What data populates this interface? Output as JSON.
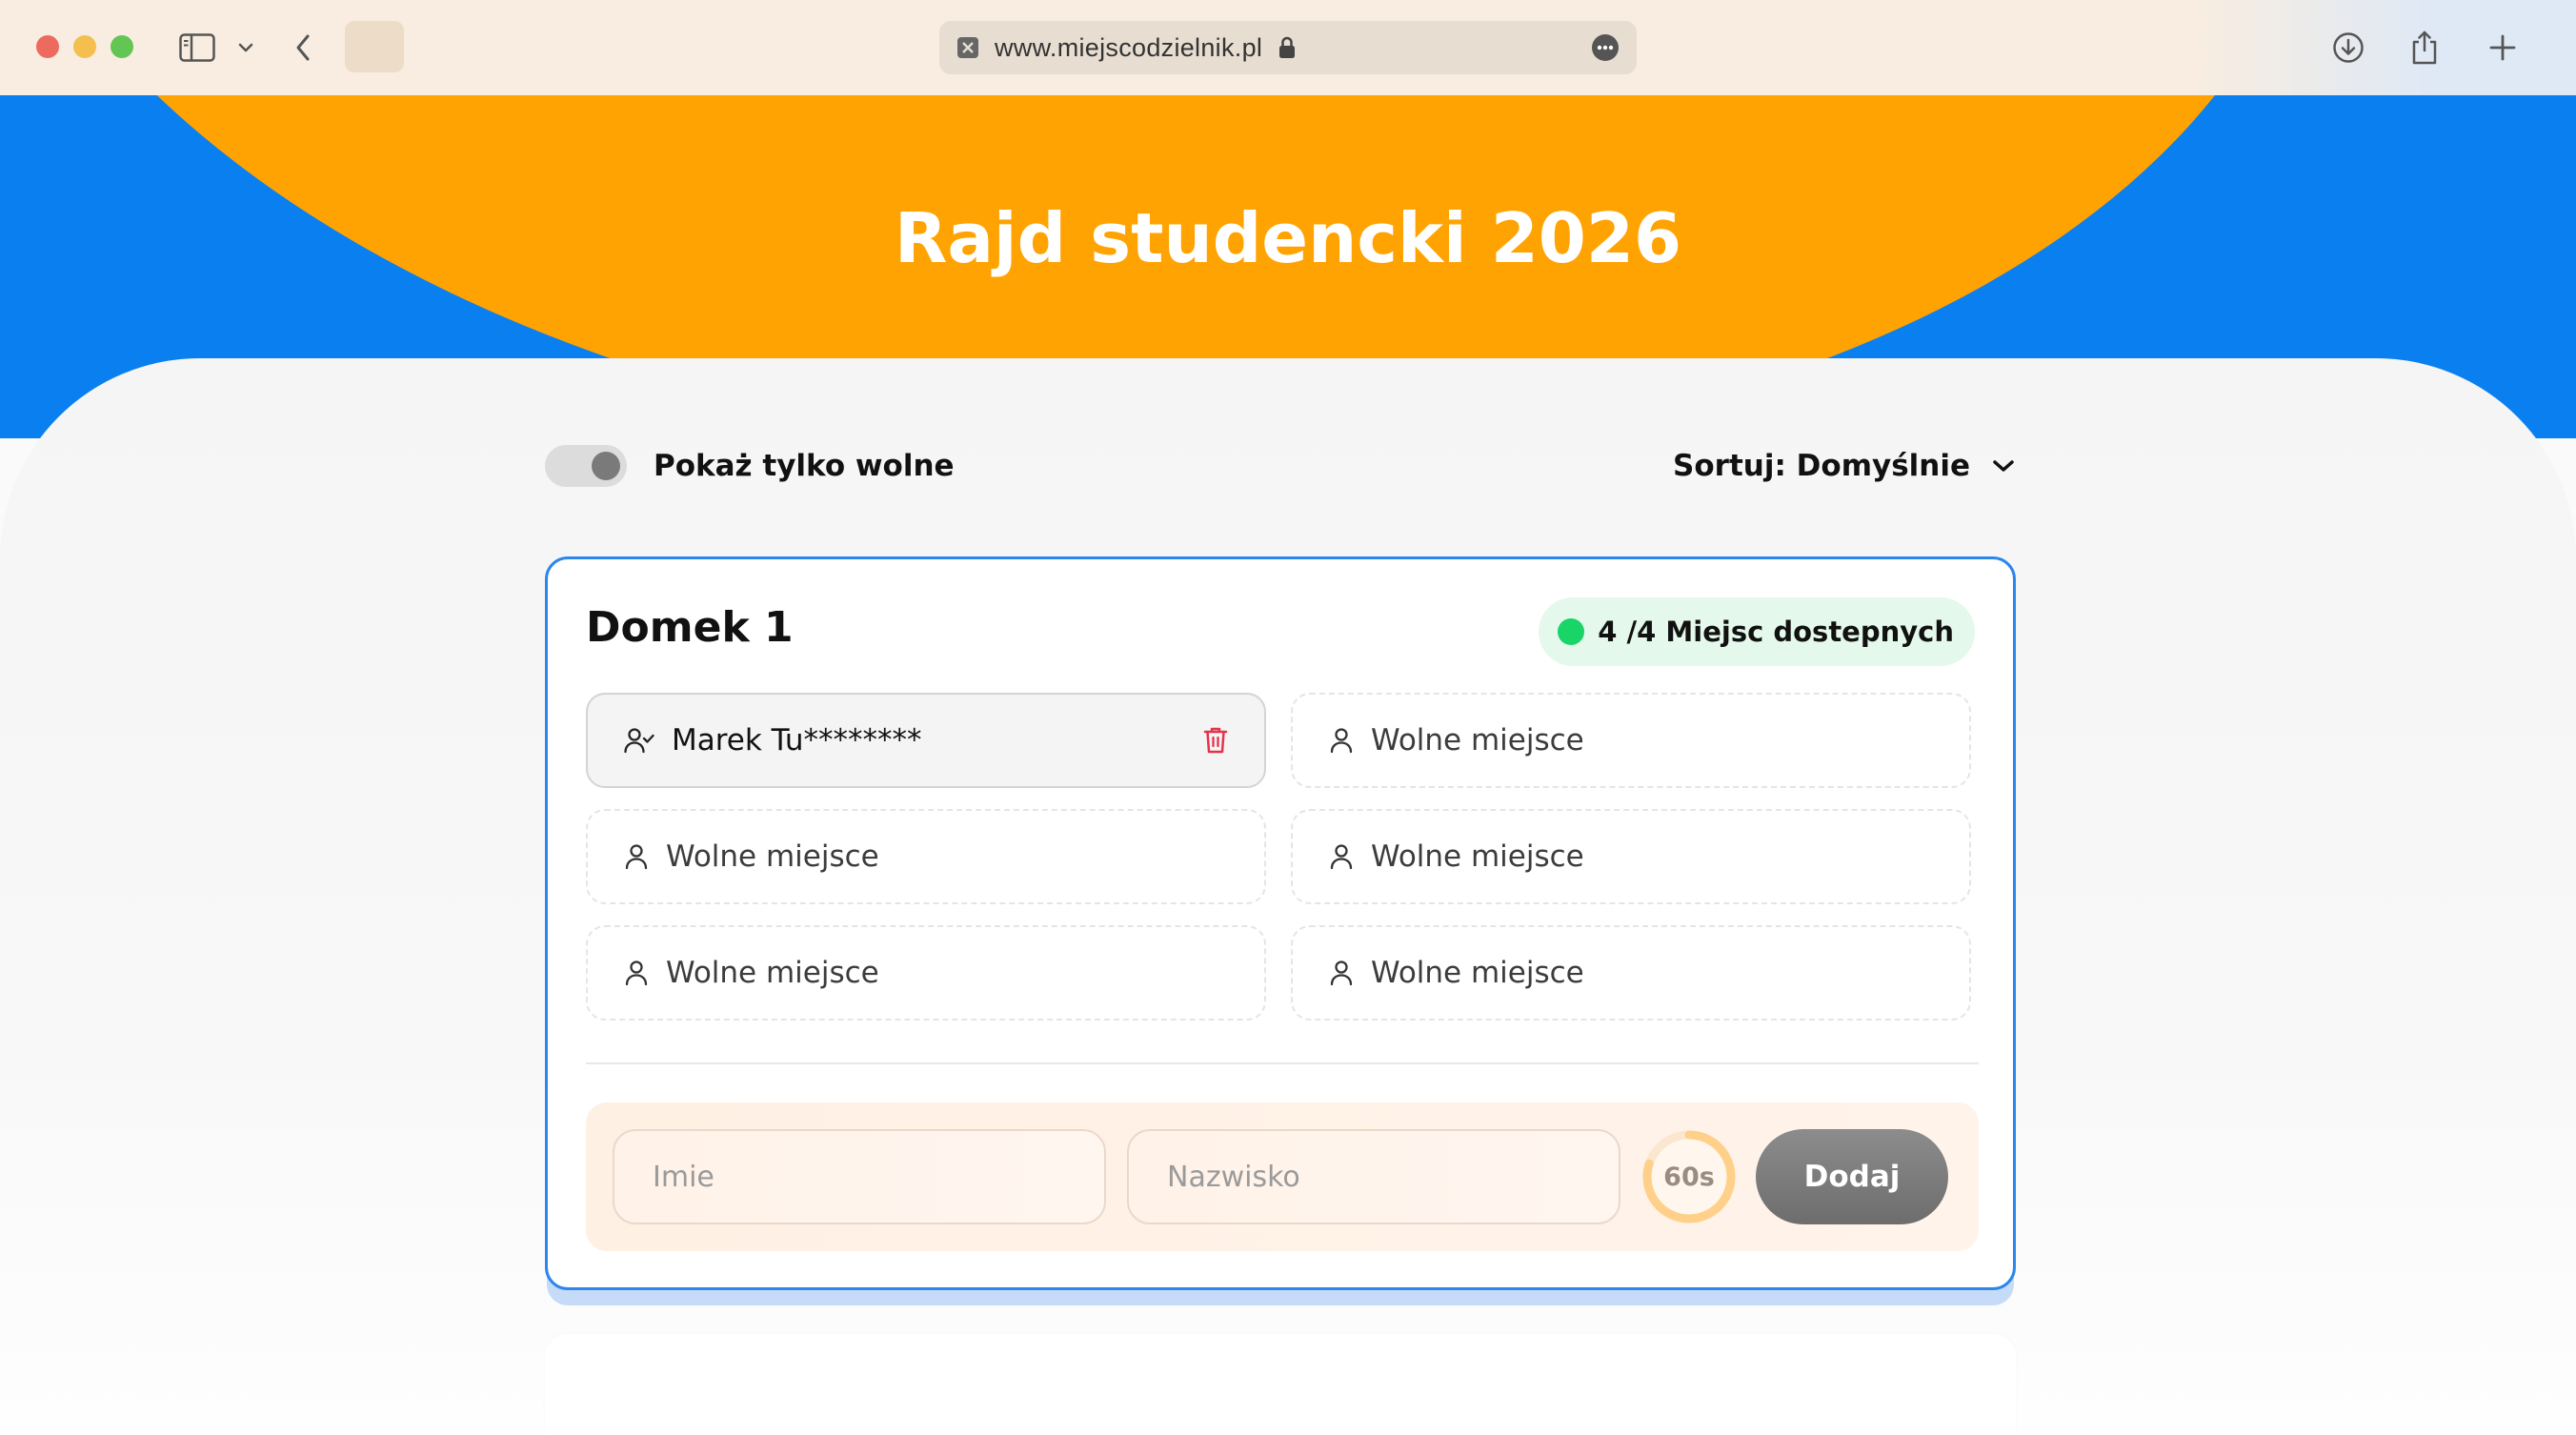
{
  "browser": {
    "url": "www.miejscodzielnik.pl"
  },
  "hero": {
    "title": "Rajd studencki 2026"
  },
  "filters": {
    "toggle_label": "Pokaż tylko wolne",
    "toggle_on": false,
    "sort_label": "Sortuj: Domyślnie"
  },
  "cabin": {
    "name": "Domek 1",
    "availability": "4 /4 Miejsc dostepnych",
    "slots": [
      {
        "label": "Marek Tu********",
        "taken": true
      },
      {
        "label": "Wolne miejsce",
        "taken": false
      },
      {
        "label": "Wolne miejsce",
        "taken": false
      },
      {
        "label": "Wolne miejsce",
        "taken": false
      },
      {
        "label": "Wolne miejsce",
        "taken": false
      },
      {
        "label": "Wolne miejsce",
        "taken": false
      }
    ],
    "form": {
      "first_name_placeholder": "Imie",
      "last_name_placeholder": "Nazwisko",
      "timer": "60s",
      "timer_fraction": 0.8,
      "submit_label": "Dodaj"
    }
  },
  "colors": {
    "accent_blue": "#0a7ff0",
    "accent_orange": "#ffa303",
    "available_green": "#19d466",
    "danger_red": "#e5334b"
  }
}
